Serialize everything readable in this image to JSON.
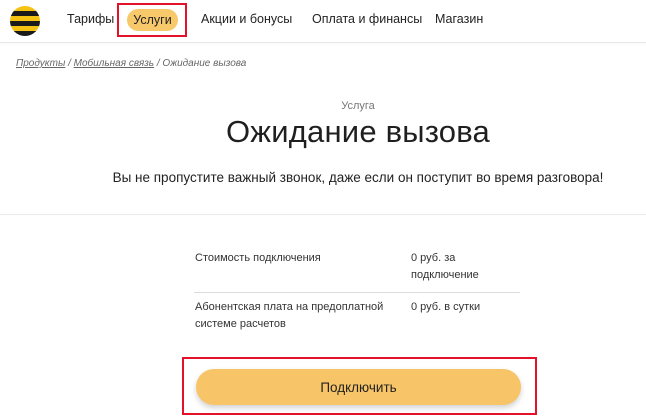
{
  "header": {
    "nav": [
      "Тарифы",
      "Услуги",
      "Акции и бонусы",
      "Оплата и финансы",
      "Магазин"
    ],
    "active_nav": "Услуги"
  },
  "breadcrumb": [
    "Продукты",
    "Мобильная связь",
    "Ожидание вызова"
  ],
  "service": {
    "eyebrow": "Услуга",
    "title": "Ожидание вызова",
    "subtitle": "Вы не пропустите важный звонок, даже если он поступит во время разговора!"
  },
  "pricing": [
    {
      "label_line1": "Стоимость подключения",
      "label_line2": "",
      "value_line1": "0 руб. за",
      "value_line2": "подключение"
    },
    {
      "label_line1": "Абонентская плата на предоплатной",
      "label_line2": "системе расчетов",
      "value_line1": "0 руб. в сутки",
      "value_line2": ""
    }
  ],
  "actions": {
    "connect_label": "Подключить"
  },
  "colors": {
    "brand_yellow": "#f7c313",
    "button_fill": "#f7c467",
    "highlight_red": "#e3122a"
  }
}
